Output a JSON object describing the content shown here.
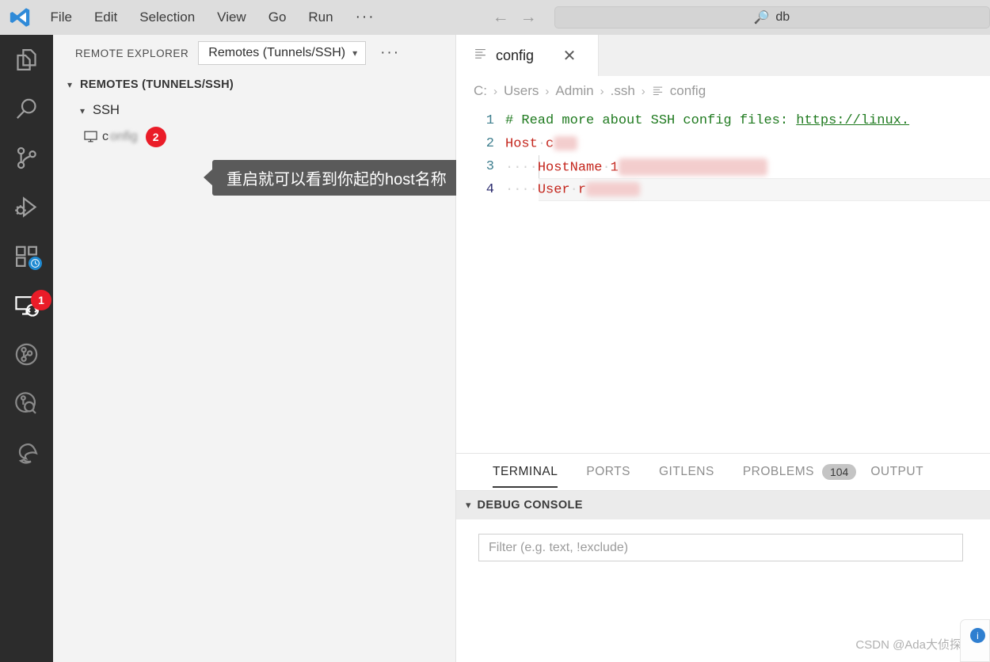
{
  "titlebar": {
    "logo_icon": "vscode-logo-icon",
    "menus": [
      "File",
      "Edit",
      "Selection",
      "View",
      "Go",
      "Run"
    ],
    "more_label": "···",
    "back_icon": "arrow-left-icon",
    "forward_icon": "arrow-right-icon",
    "search": {
      "icon": "search-icon",
      "value": "db",
      "placeholder": "db"
    }
  },
  "activitybar": {
    "items": [
      {
        "name": "explorer",
        "icon": "files-icon",
        "badge": ""
      },
      {
        "name": "search",
        "icon": "search-icon",
        "badge": ""
      },
      {
        "name": "source-control",
        "icon": "source-control-icon",
        "badge": ""
      },
      {
        "name": "run-and-debug",
        "icon": "run-debug-icon",
        "badge": ""
      },
      {
        "name": "extensions",
        "icon": "extensions-icon",
        "badge": "clock"
      },
      {
        "name": "remote-explorer",
        "icon": "remote-explorer-icon",
        "badge": "1"
      },
      {
        "name": "git-graph",
        "icon": "git-graph-icon",
        "badge": ""
      },
      {
        "name": "git-lens",
        "icon": "gitlens-search-icon",
        "badge": ""
      },
      {
        "name": "edge-tools",
        "icon": "edge-browser-icon",
        "badge": ""
      }
    ],
    "remote_badge": "1"
  },
  "sidebar": {
    "title": "REMOTE EXPLORER",
    "dropdown": {
      "label": "Remotes (Tunnels/SSH)",
      "chevron_icon": "chevron-down-icon",
      "options": [
        "Remotes (Tunnels/SSH)"
      ]
    },
    "more_icon": "more-actions-icon",
    "tree": {
      "root": {
        "label": "REMOTES (TUNNELS/SSH)",
        "chevron_icon": "chevron-down-icon"
      },
      "group": {
        "label": "SSH",
        "chevron_icon": "chevron-down-icon"
      },
      "host": {
        "icon": "remote-host-icon",
        "label": "c",
        "blurred_label": "onfig",
        "badge": "2"
      }
    },
    "callout": {
      "text": "重启就可以看到你起的host名称",
      "bg_color": "#5a5a5a",
      "text_color": "#ffffff"
    }
  },
  "editor": {
    "tab": {
      "icon": "text-file-icon",
      "label": "config",
      "close_icon": "close-icon"
    },
    "breadcrumb": {
      "items": [
        "C:",
        "Users",
        "Admin",
        ".ssh",
        "config"
      ],
      "separator": "›",
      "file_icon": "text-file-icon"
    },
    "lines": [
      {
        "number": "1",
        "kind": "comment",
        "comment": "# Read more about SSH config files: ",
        "url": "https://linux."
      },
      {
        "number": "2",
        "kind": "keyvalue",
        "key": "Host",
        "value": "c",
        "redacted_width": 28
      },
      {
        "number": "3",
        "kind": "indented",
        "key": "HostName",
        "value": "1",
        "redacted_width": 182
      },
      {
        "number": "4",
        "kind": "indented",
        "key": "User",
        "value": "r",
        "redacted_width": 64
      }
    ],
    "colors": {
      "comment": "#1f7a1f",
      "keyword": "#c4261d",
      "line_number": "#3f7f8f",
      "redaction": "#f3cdcd"
    }
  },
  "panel": {
    "tabs": [
      {
        "label": "TERMINAL",
        "active": true,
        "badge": ""
      },
      {
        "label": "PORTS",
        "active": false,
        "badge": ""
      },
      {
        "label": "GITLENS",
        "active": false,
        "badge": ""
      },
      {
        "label": "PROBLEMS",
        "active": false,
        "badge": "104"
      },
      {
        "label": "OUTPUT",
        "active": false,
        "badge": ""
      }
    ],
    "debug_console": {
      "title": "DEBUG CONSOLE",
      "chevron_icon": "chevron-down-icon",
      "filter_placeholder": "Filter (e.g. text, !exclude)",
      "filter_value": ""
    }
  },
  "watermark": {
    "text": "CSDN @Ada大侦探"
  }
}
